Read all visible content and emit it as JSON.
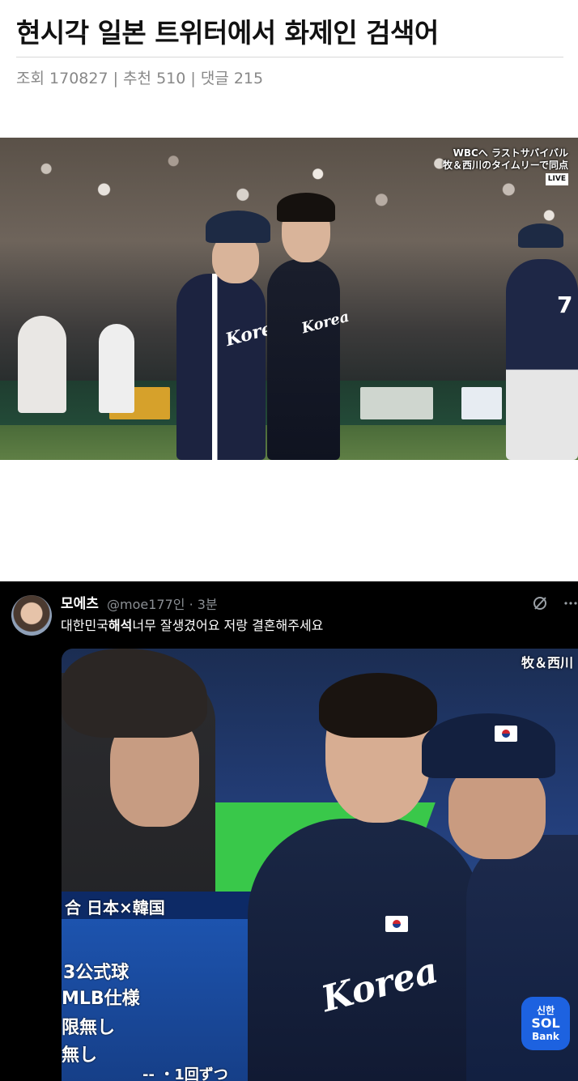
{
  "post": {
    "title": "현시각 일본 트위터에서 화제인 검색어",
    "views_label": "조회",
    "views": "170827",
    "recommend_label": "추천",
    "recommend": "510",
    "comments_label": "댓글",
    "comments": "215",
    "separator": "|"
  },
  "image1": {
    "overlay_line1": "WBCへ ラストサバイバル",
    "overlay_line2": "牧＆西川のタイムリーで同点",
    "live": "LIVE",
    "jersey_text": "Korea",
    "number": "7"
  },
  "tweet": {
    "name": "모에츠",
    "handle": "@moe177인 · 3분",
    "text_prefix": "대한민국",
    "text_bold": "해석",
    "text_suffix": "너무 잘생겼어요 저랑 결혼해주세요",
    "media": {
      "overlay_top": "牧＆西川",
      "score_header": "合 日本×韓国",
      "line1": "3公式球",
      "line2": "MLB仕様",
      "line3": "限無し",
      "line4": "無し",
      "line5": "-- ・1回ずつ",
      "jersey_text": "Korea",
      "sol_top": "신한",
      "sol_mid": "SOL",
      "sol_bottom": "Bank"
    }
  },
  "colors": {
    "title": "#111111",
    "meta": "#888888",
    "tweet_bg": "#000000",
    "handle": "#8b8f94"
  },
  "icons": [
    "grok-icon",
    "more-icon"
  ]
}
